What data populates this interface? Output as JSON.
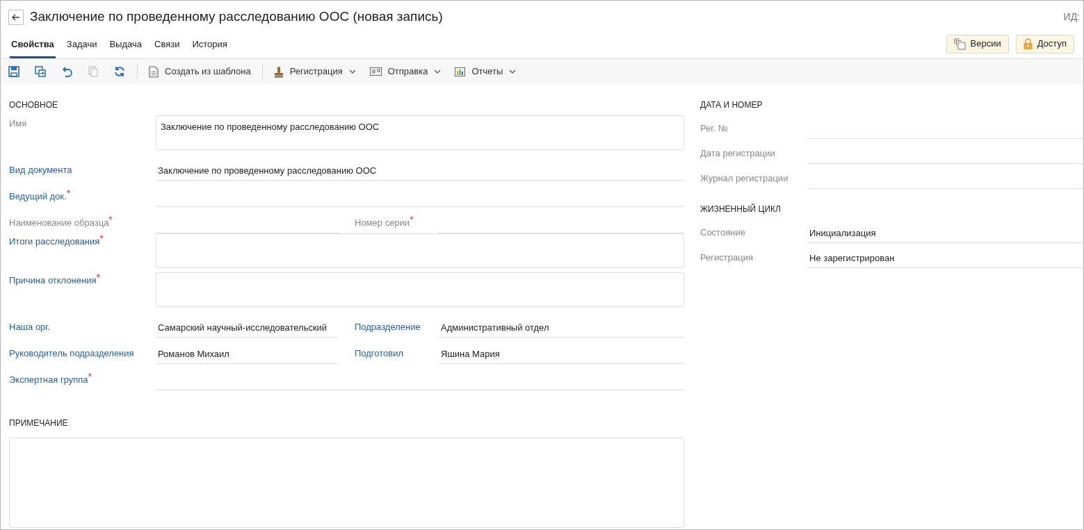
{
  "header": {
    "title": "Заключение по проведенному расследованию ООС (новая запись)",
    "id_label": "ИД:"
  },
  "tabs": [
    {
      "label": "Свойства",
      "selected": true
    },
    {
      "label": "Задачи",
      "selected": false
    },
    {
      "label": "Выдача",
      "selected": false
    },
    {
      "label": "Связи",
      "selected": false
    },
    {
      "label": "История",
      "selected": false
    }
  ],
  "header_buttons": [
    {
      "label": "Версии",
      "kind": "versions"
    },
    {
      "label": "Доступ",
      "kind": "access"
    }
  ],
  "toolbar": {
    "icons": [
      {
        "kind": "save",
        "disabled": false
      },
      {
        "kind": "save-as",
        "disabled": false
      },
      {
        "kind": "undo",
        "disabled": false
      },
      {
        "kind": "copy",
        "disabled": true
      },
      {
        "kind": "refresh",
        "disabled": false
      }
    ],
    "actions": [
      {
        "label": "Создать из шаблона",
        "kind": "template",
        "dropdown": false
      },
      {
        "label": "Регистрация",
        "kind": "stamp",
        "dropdown": true
      },
      {
        "label": "Отправка",
        "kind": "send",
        "dropdown": true
      },
      {
        "label": "Отчеты",
        "kind": "report",
        "dropdown": true
      }
    ]
  },
  "main_section": {
    "title": "ОСНОВНОЕ",
    "rows": [
      {
        "fields": [
          {
            "label": "Имя",
            "link": false,
            "kind": "area",
            "value": "Заключение по проведенному расследованию ООС"
          }
        ]
      },
      {
        "fields": [
          {
            "label": "Вид документа",
            "link": true,
            "kind": "line",
            "value": "Заключение по проведенному расследованию ООС"
          }
        ]
      },
      {
        "fields": [
          {
            "label": "Ведущий док.",
            "link": true,
            "required_mark": "*",
            "kind": "line"
          }
        ]
      },
      {
        "fields": [
          {
            "label": "Наименование образца",
            "link": false,
            "required_mark": "*",
            "kind": "line"
          },
          {
            "label": "Номер серии",
            "link": false,
            "required_mark": "*",
            "kind": "line"
          }
        ]
      },
      {
        "fields": [
          {
            "label": "Итоги расследования",
            "link": true,
            "required_mark": "*",
            "kind": "area"
          }
        ]
      },
      {
        "fields": [
          {
            "label": "Причина отклонения",
            "link": true,
            "required_mark": "*",
            "kind": "area"
          }
        ]
      },
      {
        "fields": [
          {
            "label": "Наша орг.",
            "link": true,
            "kind": "line",
            "value": "Самарский научный-исследовательский"
          },
          {
            "label": "Подразделение",
            "link": true,
            "kind": "line",
            "value": "Административный отдел"
          }
        ]
      },
      {
        "fields": [
          {
            "label": "Руководитель подразделения",
            "link": true,
            "kind": "line",
            "value": "Романов Михаил"
          },
          {
            "label": "Подготовил",
            "link": true,
            "kind": "line",
            "value": "Яшина Мария"
          }
        ]
      },
      {
        "fields": [
          {
            "label": "Экспертная группа",
            "link": true,
            "required_mark": "*",
            "kind": "line"
          }
        ]
      }
    ]
  },
  "right_sections": [
    {
      "title": "ДАТА И НОМЕР",
      "fields": [
        {
          "label": "Рег. №"
        },
        {
          "label": "Дата регистрации"
        },
        {
          "label": "Журнал регистрации"
        }
      ]
    },
    {
      "title": "ЖИЗНЕННЫЙ ЦИКЛ",
      "fields": [
        {
          "label": "Состояние",
          "value": "Инициализация"
        },
        {
          "label": "Регистрация",
          "value": "Не зарегистрирован"
        }
      ]
    }
  ],
  "note": {
    "title": "ПРИМЕЧАНИЕ"
  }
}
